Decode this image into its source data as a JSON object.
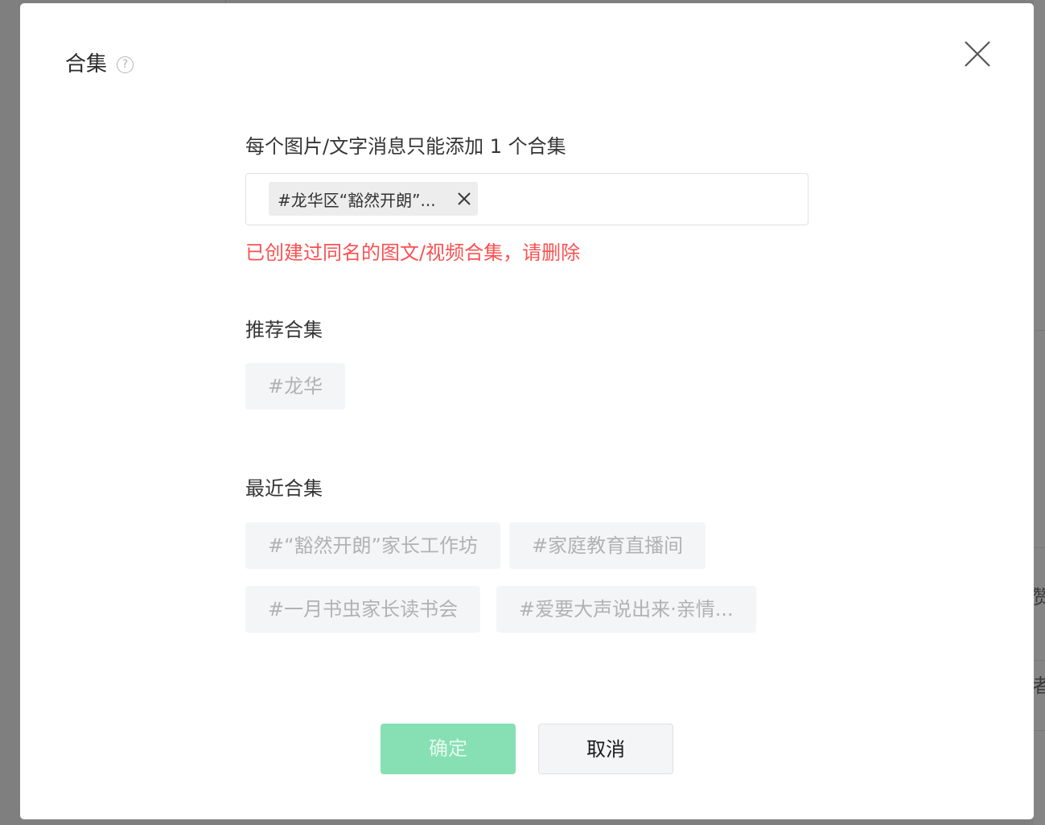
{
  "dialog": {
    "title": "合集",
    "help_icon_glyph": "?",
    "close_icon": "close-icon"
  },
  "form": {
    "hint": "每个图片/文字消息只能添加 1 个合集",
    "selected_tag": {
      "label": "#龙华区“豁然开朗”...",
      "remove_icon": "close-icon"
    },
    "error": "已创建过同名的图文/视频合集，请删除"
  },
  "recommended": {
    "title": "推荐合集",
    "items": [
      "#龙华"
    ]
  },
  "recent": {
    "title": "最近合集",
    "items": [
      "#“豁然开朗”家长工作坊",
      "#家庭教育直播间",
      "#一月书虫家长读书会",
      "#爱要大声说出来·亲情..."
    ]
  },
  "buttons": {
    "confirm": "确定",
    "cancel": "取消"
  },
  "background": {
    "partial_chars": [
      "赞",
      "者"
    ]
  },
  "colors": {
    "error": "#fa5151",
    "confirm_bg_disabled": "#86e0b3",
    "chip_bg": "#f4f5f7",
    "overlay": "#7f7f7f"
  }
}
